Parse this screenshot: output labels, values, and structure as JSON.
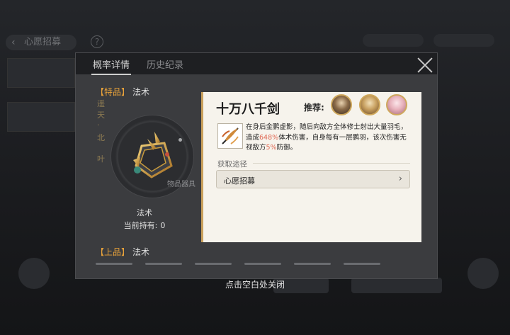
{
  "background": {
    "back_label": "心愿招募",
    "help_glyph": "?"
  },
  "panel": {
    "tabs": [
      {
        "label": "概率详情",
        "active": true
      },
      {
        "label": "历史纪录",
        "active": false
      }
    ],
    "grades": [
      {
        "tier": "【特品】",
        "text": "法术"
      },
      {
        "tier": "【上品】",
        "text": "法术"
      }
    ]
  },
  "item": {
    "name": "十万八千剑",
    "category": "物品器具",
    "type_label": "法术",
    "hold_label": "当前持有:",
    "hold_value": "0",
    "side_glyphs": [
      "遥",
      "天",
      "·",
      "北",
      "叶"
    ]
  },
  "card": {
    "recommend_label": "推荐:",
    "description_parts": [
      {
        "t": "在身后金鹏虚影，随后向敌方全体修士射出大量羽毛，造成",
        "hl": false
      },
      {
        "t": "648%",
        "hl": true
      },
      {
        "t": "体术伤害，自身每有一层鹏羽，该次伤害无视敌方",
        "hl": false
      },
      {
        "t": "5%",
        "hl": true
      },
      {
        "t": "防御。",
        "hl": false
      }
    ],
    "source_title": "获取途径",
    "source_button": "心愿招募"
  },
  "hint": "点击空白处关闭",
  "colors": {
    "accent_gold": "#c9a05b",
    "highlight_red": "#e06a55",
    "card_bg": "#f6f3ec"
  },
  "icons": [
    "close-icon",
    "chevron-right-icon",
    "sword-artifact-icon",
    "feather-skill-icon"
  ]
}
